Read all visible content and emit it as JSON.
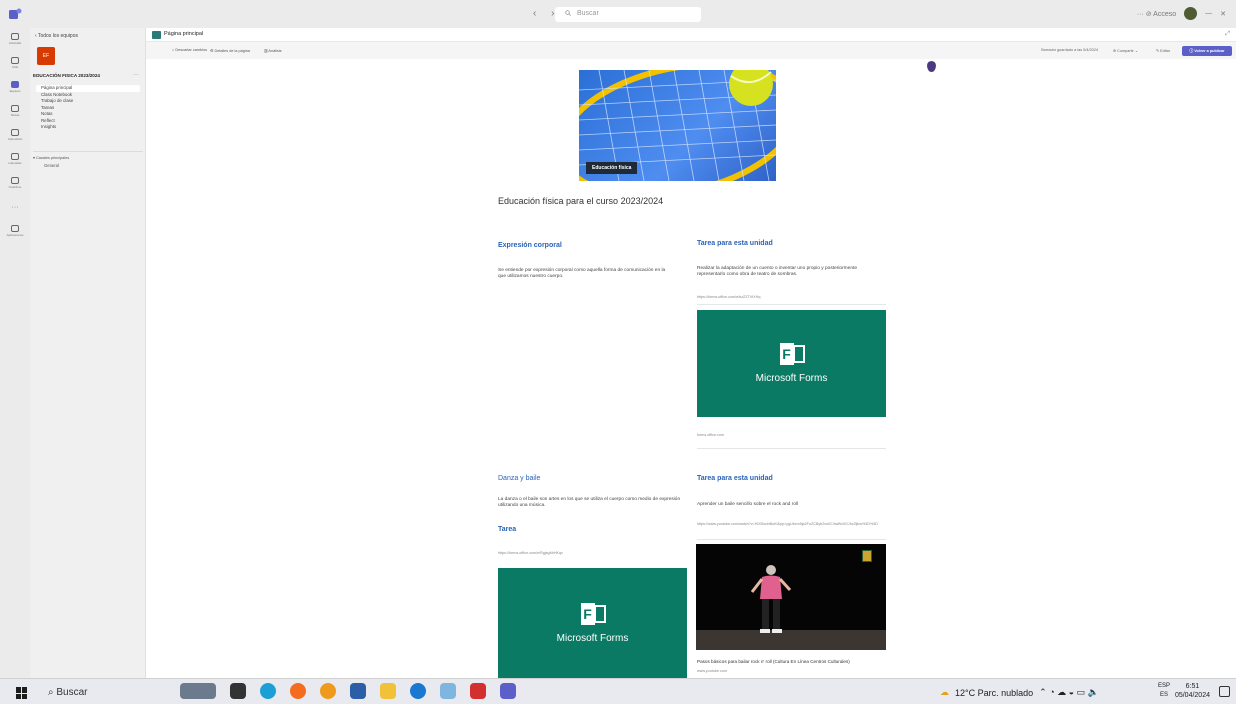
{
  "window": {
    "search_placeholder": "Buscar",
    "nav_arrows": "‹ ›",
    "right_controls": "··· ⊘ Acceso"
  },
  "rail": {
    "items": [
      {
        "label": "Actividad"
      },
      {
        "label": "Chat"
      },
      {
        "label": "Equipos"
      },
      {
        "label": "Tareas"
      },
      {
        "label": "Calendario"
      },
      {
        "label": "Llamadas"
      },
      {
        "label": "OneDrive"
      },
      {
        "label": "···"
      },
      {
        "label": "Aplicaciones"
      }
    ]
  },
  "sidebar": {
    "back_label": "‹ Todos los equipos",
    "team_initials": "EF",
    "team_name": "EDUCACIÓN FISICA 2023/2024",
    "team_more": "···",
    "nav": [
      "Página principal",
      "Class Notebook",
      "Trabajo de clase",
      "Tareas",
      "Notas",
      "Reflect",
      "Insights"
    ],
    "channels_header": "▾ Canales principales",
    "channel_general": "General"
  },
  "page": {
    "title": "Página principal",
    "commands": {
      "discard": "⌂ Descartar cambios",
      "details": "⚙ Detalles de la página",
      "analytics": "▥ Análisis"
    },
    "draft_status": "Borrador guardado a las 5/4/2024",
    "share": "⊚ Compartir ⌄",
    "edit": "✎ Editar",
    "publish": "ⓘ Volver a publicar"
  },
  "content": {
    "hero_caption": "Educación física",
    "heading": "Educación física para el curso 2023/2024",
    "sec1_title": "Expresión corporal",
    "sec1_text": "Se entiende por expresión corporal como aquella forma de comunicación en la que utilizamos nuestro cuerpo.",
    "task1_title": "Tarea para esta unidad",
    "task1_text": "Realizar la adaptación de un cuento o inventar uno propio y posteriormente representarlo como obra de teatro de sombras.",
    "task1_link": "https://forms.office.com/e/bzZZTVtXHq",
    "forms_label": "Microsoft Forms",
    "forms_domain": "forms.office.com",
    "sec2_title": "Danza y baile",
    "sec2_text": "La danza o el baile son artes en los que se utiliza el cuerpo como medio de expresión utilizando una música.",
    "tarea_title": "Tarea",
    "tarea_link": "https://forms.office.com/e/RgjsgMrHKqx",
    "task2_title": "Tarea para esta unidad",
    "task2_text": "Aprender un baile sencillo sobre el rock and roll",
    "task2_link": "https://www.youtube.com/watch?v=9O05cdnBuKl&pp=ygUbcm9ja2FuZCByb2xsIGJhaWxlIGJhc2ljbw%3D%3D",
    "video_caption": "Pasos básicos para bailar rock n' roll (Cultura En Línea Centros Culturales)",
    "video_domain": "www.youtube.com"
  },
  "taskbar": {
    "search": "Buscar",
    "weather": "12°C Parc. nublado",
    "lang_top": "ESP",
    "lang_bottom": "ES",
    "time": "6:51",
    "date": "05/04/2024"
  },
  "colors": {
    "accent": "#5b5fc7",
    "forms_green": "#0b7a64",
    "team_tile": "#d83b01",
    "link_blue": "#2a63b8"
  }
}
